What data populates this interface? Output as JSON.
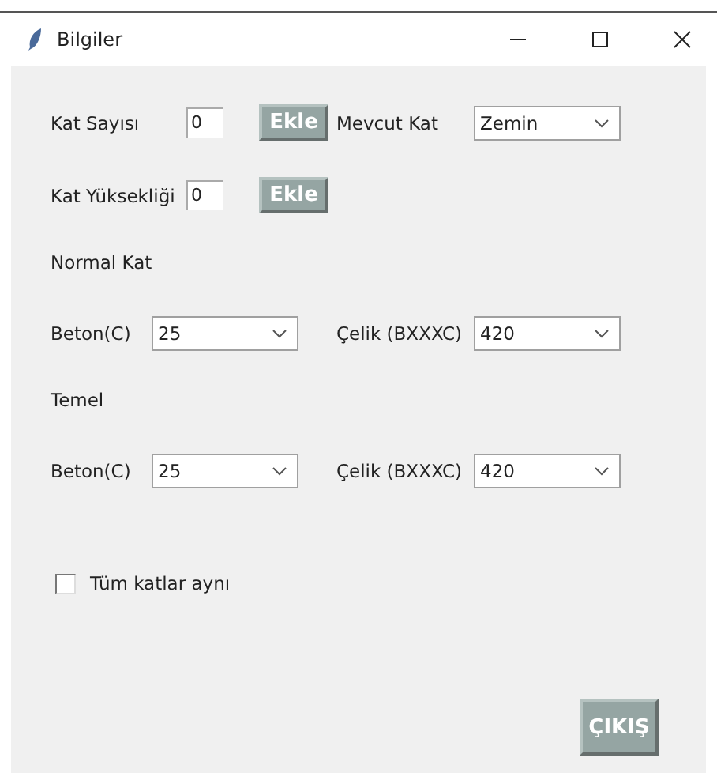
{
  "window": {
    "title": "Bilgiler"
  },
  "floor_count": {
    "label": "Kat Sayısı",
    "value": "0",
    "button": "Ekle"
  },
  "current_floor": {
    "label": "Mevcut Kat",
    "value": "Zemin"
  },
  "floor_height": {
    "label": "Kat Yüksekliği",
    "value": "0",
    "button": "Ekle"
  },
  "sections": [
    {
      "title": "Normal Kat",
      "concrete": {
        "label": "Beton(C)",
        "value": "25"
      },
      "steel": {
        "label": "Çelik (BXXXC)",
        "value": "420"
      }
    },
    {
      "title": "Temel",
      "concrete": {
        "label": "Beton(C)",
        "value": "25"
      },
      "steel": {
        "label": "Çelik (BXXXC)",
        "value": "420"
      }
    }
  ],
  "same_all": {
    "label": "Tüm katlar aynı",
    "checked": false
  },
  "exit_button": "ÇIKIŞ"
}
